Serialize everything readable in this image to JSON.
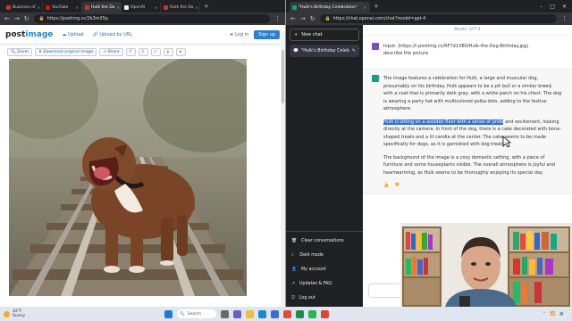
{
  "left_browser": {
    "tabs": [
      {
        "label": "Business of",
        "color": "#d32f2f"
      },
      {
        "label": "YouTube",
        "color": "#ff0000"
      },
      {
        "label": "Hulk the Do",
        "color": "#d32f2f"
      },
      {
        "label": "OpenAI",
        "color": "#ffffff"
      },
      {
        "label": "Hulk the Do",
        "color": "#d32f2f"
      }
    ],
    "url": "https://postimg.cc/2b3mX5p"
  },
  "postimage": {
    "logo_pre": "post",
    "logo_post": "image",
    "upload_label": "Upload",
    "upload_by_url_label": "Upload by URL",
    "login_label": "Log in",
    "signup_label": "Sign up",
    "toolbar": {
      "zoom_label": "Zoom",
      "download_label": "Download original image",
      "share_label": "Share",
      "icons": [
        "f",
        "t",
        "r",
        "p",
        "e"
      ]
    }
  },
  "right_browser": {
    "tab_title": "\"Hulk's Birthday Celebration\"",
    "url": "https://chat.openai.com/chat?model=gpt-4"
  },
  "chatgpt": {
    "new_chat_label": "New chat",
    "conversation_title": "\"Hulk's Birthday Celeb",
    "model_label": "Model: GPT-4",
    "user_message_line1": "Input: (https://i.postimg.cc/RF7d1XB0/Hulk-the-Dog-Birthday.jpg)",
    "user_message_line2": "describe the picture",
    "bot_paragraph1": "The image features a celebration for Hulk, a large and muscular dog, presumably on his birthday. Hulk appears to be a pit bull or a similar breed, with a coat that is primarily dark gray, with a white patch on his chest. The dog is wearing a party hat with multicolored polka dots, adding to the festive atmosphere.",
    "bot_highlight": "Hulk is sitting on a wooden floor with a sense of pride",
    "bot_paragraph2_rest": " and excitement, looking directly at the camera. In front of the dog, there is a cake decorated with bone-shaped treats and a lit candle at the center. The cake seems to be made specifically for dogs, as it is garnished with dog treats.",
    "bot_paragraph3": "The background of the image is a cozy domestic setting, with a piece of furniture and some houseplants visible. The overall atmosphere is joyful and heartwarming, as Hulk seems to be thoroughly enjoying its special day.",
    "sidebar_bottom": {
      "clear_label": "Clear conversations",
      "dark_label": "Dark mode",
      "account_label": "My account",
      "updates_label": "Updates & FAQ",
      "logout_label": "Log out"
    }
  },
  "taskbar": {
    "temp": "42°F",
    "weather": "Sunny",
    "search_label": "Search"
  }
}
